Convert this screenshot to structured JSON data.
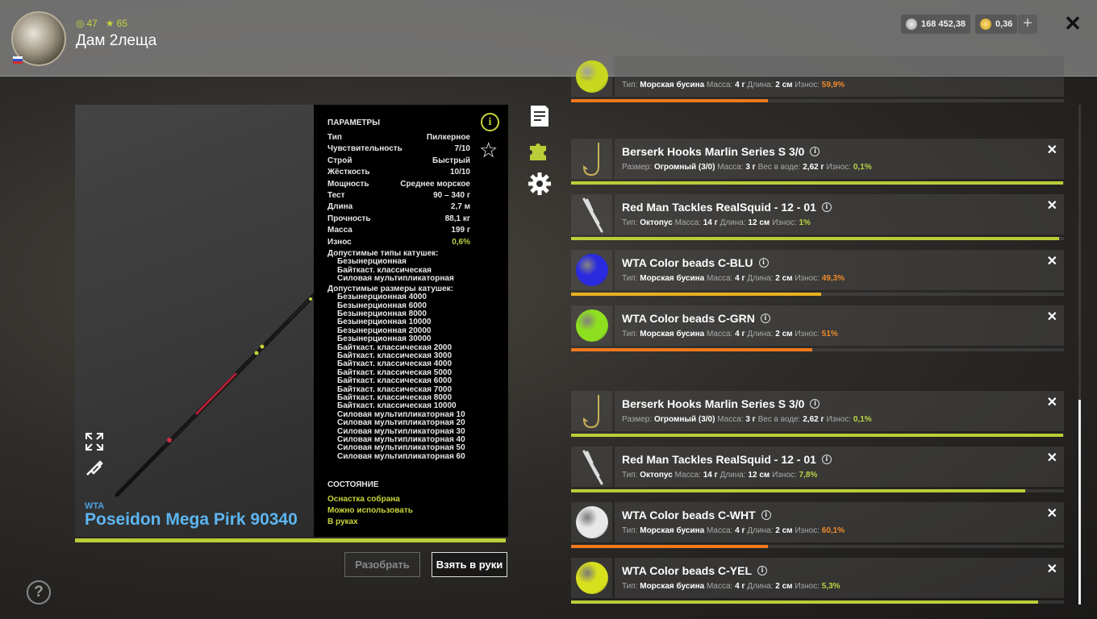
{
  "header": {
    "level": "47",
    "rank": "65",
    "player_name": "Дам 2леща",
    "silver": "168 452,38",
    "gold": "0,36"
  },
  "rod": {
    "brand": "WTA",
    "name": "Poseidon Mega Pirk 90340",
    "params_title": "ПАРАМЕТРЫ",
    "params": [
      {
        "label": "Тип",
        "value": "Пилкерное"
      },
      {
        "label": "Чувствительность",
        "value": "7/10"
      },
      {
        "label": "Строй",
        "value": "Быстрый"
      },
      {
        "label": "Жёсткость",
        "value": "10/10"
      },
      {
        "label": "Мощность",
        "value": "Среднее морское"
      },
      {
        "label": "Тест",
        "value": "90 – 340 г"
      },
      {
        "label": "Длина",
        "value": "2,7 м"
      },
      {
        "label": "Прочность",
        "value": "88,1 кг"
      },
      {
        "label": "Масса",
        "value": "199 г"
      },
      {
        "label": "Износ",
        "value": "0,6%"
      }
    ],
    "reel_types_title": "Допустимые типы катушек:",
    "reel_types": [
      "Безынерционная",
      "Байткаст. классическая",
      "Силовая мультипликаторная"
    ],
    "reel_sizes_title": "Допустимые размеры катушек:",
    "reel_sizes": [
      "Безынерционная 4000",
      "Безынерционная 6000",
      "Безынерционная 8000",
      "Безынерционная 10000",
      "Безынерционная 20000",
      "Безынерционная 30000",
      "Байткаст. классическая 2000",
      "Байткаст. классическая 3000",
      "Байткаст. классическая 4000",
      "Байткаст. классическая 5000",
      "Байткаст. классическая 6000",
      "Байткаст. классическая 7000",
      "Байткаст. классическая 8000",
      "Байткаст. классическая 10000",
      "Силовая мультипликаторная 10",
      "Силовая мультипликаторная 20",
      "Силовая мультипликаторная 30",
      "Силовая мультипликаторная 40",
      "Силовая мультипликаторная 50",
      "Силовая мультипликаторная 60"
    ],
    "state_title": "СОСТОЯНИЕ",
    "states": [
      "Оснастка собрана",
      "Можно использовать",
      "В руках"
    ],
    "wear_fraction": 0.994
  },
  "buttons": {
    "disassemble": "Разобрать",
    "take": "Взять в руки"
  },
  "labels": {
    "type": "Тип:",
    "mass": "Масса:",
    "length": "Длина:",
    "wear": "Износ:",
    "size": "Размер:",
    "weight_water": "Вес в воде:"
  },
  "items": [
    {
      "name": "",
      "kind": "bead",
      "color": "#c8d81e",
      "stats": [
        [
          "Тип:",
          "Морская бусина"
        ],
        [
          "Масса:",
          "4 г"
        ],
        [
          "Длина:",
          "2 см"
        ]
      ],
      "wear": "59,9%",
      "wear_class": "w-orange",
      "bar_color": "#f07a1e",
      "bar_fraction": 0.4
    },
    {
      "name": "Berserk Hooks Marlin Series S 3/0",
      "kind": "hook",
      "stats": [
        [
          "Размер:",
          "Огромный (3/0)"
        ],
        [
          "Масса:",
          "3 г"
        ],
        [
          "Вес в воде:",
          "2,62 г"
        ]
      ],
      "wear": "0,1%",
      "wear_class": "w-green",
      "bar_color": "#b9ce38",
      "bar_fraction": 0.999
    },
    {
      "name": "Red Man Tackles RealSquid - 12 - 01",
      "kind": "squid",
      "stats": [
        [
          "Тип:",
          "Октопус"
        ],
        [
          "Масса:",
          "14 г"
        ],
        [
          "Длина:",
          "12 см"
        ]
      ],
      "wear": "1%",
      "wear_class": "w-green",
      "bar_color": "#b9ce38",
      "bar_fraction": 0.99
    },
    {
      "name": "WTA Color beads C-BLU",
      "kind": "bead",
      "color": "#2a2ae0",
      "stats": [
        [
          "Тип:",
          "Морская бусина"
        ],
        [
          "Масса:",
          "4 г"
        ],
        [
          "Длина:",
          "2 см"
        ]
      ],
      "wear": "49,3%",
      "wear_class": "w-orange",
      "bar_color": "#e8b020",
      "bar_fraction": 0.507
    },
    {
      "name": "WTA Color beads C-GRN",
      "kind": "bead",
      "color": "#8ee01e",
      "stats": [
        [
          "Тип:",
          "Морская бусина"
        ],
        [
          "Масса:",
          "4 г"
        ],
        [
          "Длина:",
          "2 см"
        ]
      ],
      "wear": "51%",
      "wear_class": "w-orange",
      "bar_color": "#f07a1e",
      "bar_fraction": 0.49
    },
    {
      "name": "Berserk Hooks Marlin Series S 3/0",
      "kind": "hook",
      "stats": [
        [
          "Размер:",
          "Огромный (3/0)"
        ],
        [
          "Масса:",
          "3 г"
        ],
        [
          "Вес в воде:",
          "2,62 г"
        ]
      ],
      "wear": "0,1%",
      "wear_class": "w-green",
      "bar_color": "#b9ce38",
      "bar_fraction": 0.999
    },
    {
      "name": "Red Man Tackles RealSquid - 12 - 01",
      "kind": "squid",
      "stats": [
        [
          "Тип:",
          "Октопус"
        ],
        [
          "Масса:",
          "14 г"
        ],
        [
          "Длина:",
          "12 см"
        ]
      ],
      "wear": "7,8%",
      "wear_class": "w-green",
      "bar_color": "#b9ce38",
      "bar_fraction": 0.922
    },
    {
      "name": "WTA Color beads C-WHT",
      "kind": "bead",
      "color": "#e8e8e8",
      "stats": [
        [
          "Тип:",
          "Морская бусина"
        ],
        [
          "Масса:",
          "4 г"
        ],
        [
          "Длина:",
          "2 см"
        ]
      ],
      "wear": "60,1%",
      "wear_class": "w-orange",
      "bar_color": "#f07a1e",
      "bar_fraction": 0.399
    },
    {
      "name": "WTA Color beads C-YEL",
      "kind": "bead",
      "color": "#d8e01e",
      "stats": [
        [
          "Тип:",
          "Морская бусина"
        ],
        [
          "Масса:",
          "4 г"
        ],
        [
          "Длина:",
          "2 см"
        ]
      ],
      "wear": "5,3%",
      "wear_class": "w-green",
      "bar_color": "#b9ce38",
      "bar_fraction": 0.947
    }
  ],
  "colors": {
    "accent": "#b9ce38",
    "rod_title": "#5cb6f0",
    "warning": "#f07a1e"
  }
}
